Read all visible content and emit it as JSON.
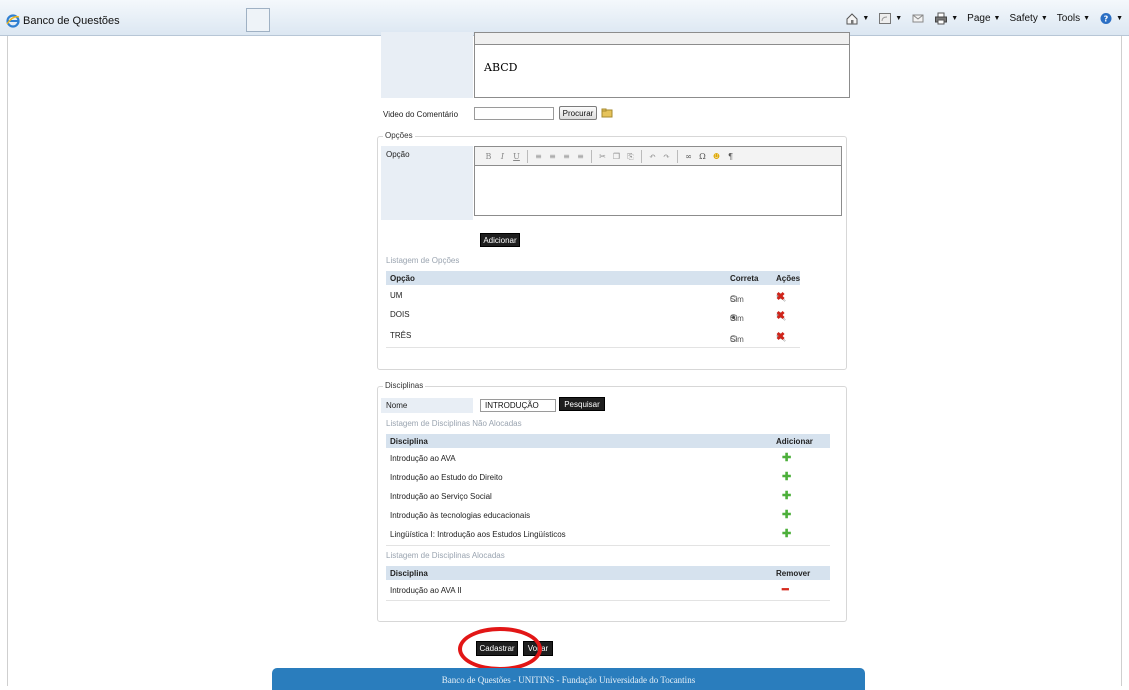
{
  "browser": {
    "tab_title": "Banco de Questões",
    "commands": [
      {
        "label": "Page"
      },
      {
        "label": "Safety"
      },
      {
        "label": "Tools"
      }
    ]
  },
  "comment_editor": {
    "content": "ABCD"
  },
  "video": {
    "label": "Video do Comentário",
    "browse_button": "Procurar"
  },
  "options": {
    "legend": "Opções",
    "field_label": "Opção",
    "add_button": "Adicionar",
    "list_caption": "Listagem de Opções",
    "columns": {
      "option": "Opção",
      "correct": "Correta",
      "actions": "Ações"
    },
    "rows": [
      {
        "option": "UM",
        "correct_label": "Sim",
        "checked": false
      },
      {
        "option": "DOIS",
        "correct_label": "Sim",
        "checked": true
      },
      {
        "option": "TRÊS",
        "correct_label": "Sim",
        "checked": false
      }
    ]
  },
  "disciplines": {
    "legend": "Disciplinas",
    "name_label": "Nome",
    "name_value": "INTRODUÇÃO",
    "search_button": "Pesquisar",
    "unallocated_caption": "Listagem de Disciplinas Não Alocadas",
    "unallocated_columns": {
      "discipline": "Disciplina",
      "action": "Adicionar"
    },
    "unallocated": [
      "Introdução ao AVA",
      "Introdução ao Estudo do Direito",
      "Introdução ao Serviço Social",
      "Introdução às tecnologias educacionais",
      "Lingüística I: Introdução aos Estudos Lingüísticos"
    ],
    "allocated_caption": "Listagem de Disciplinas Alocadas",
    "allocated_columns": {
      "discipline": "Disciplina",
      "action": "Remover"
    },
    "allocated": [
      "Introdução ao AVA II"
    ]
  },
  "actions": {
    "submit": "Cadastrar",
    "back": "Voltar"
  },
  "footer": {
    "text": "Banco de Questões - UNITINS - Fundação Universidade do Tocantins"
  },
  "colors": {
    "footer_bg": "#2a7dbd",
    "highlight_circle": "#e21616",
    "grid_header": "#d6e2ee"
  }
}
